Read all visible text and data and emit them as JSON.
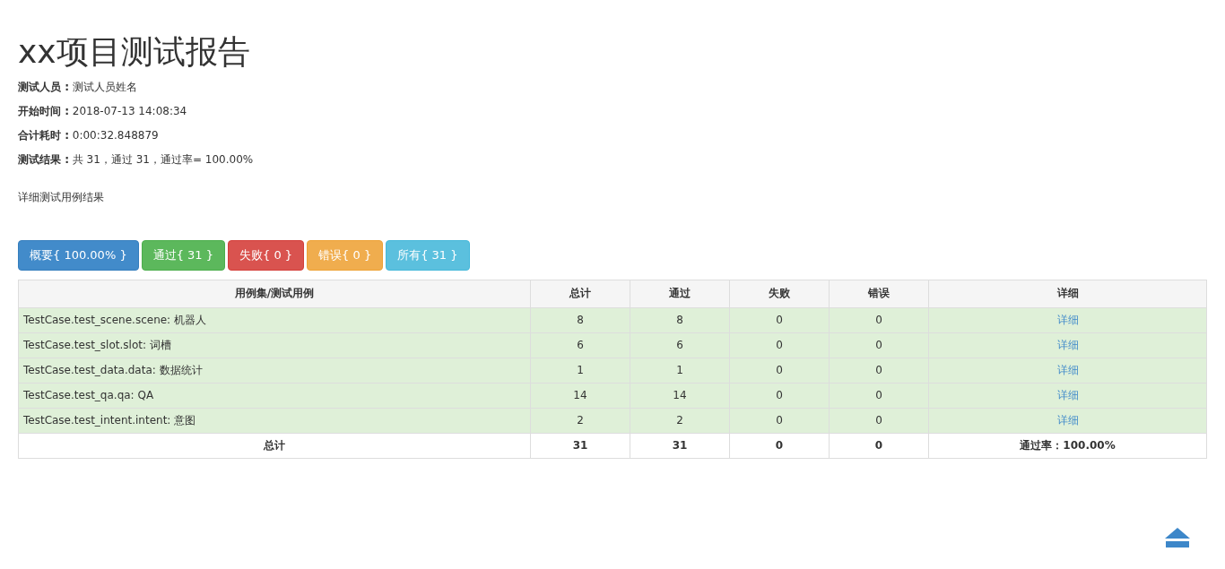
{
  "title": "xx项目测试报告",
  "info": [
    {
      "label": "测试人员 :",
      "value": "测试人员姓名"
    },
    {
      "label": "开始时间 :",
      "value": "2018-07-13 14:08:34"
    },
    {
      "label": "合计耗时 :",
      "value": "0:00:32.848879"
    },
    {
      "label": "测试结果 :",
      "value": "共 31，通过 31，通过率= 100.00%"
    }
  ],
  "description": "详细测试用例结果",
  "filter_buttons": [
    {
      "label": "概要{ 100.00% }",
      "kind": "primary"
    },
    {
      "label": "通过{ 31 }",
      "kind": "success"
    },
    {
      "label": "失败{ 0 }",
      "kind": "danger"
    },
    {
      "label": "错误{ 0 }",
      "kind": "warning"
    },
    {
      "label": "所有{ 31 }",
      "kind": "info"
    }
  ],
  "table": {
    "columns": [
      "用例集/测试用例",
      "总计",
      "通过",
      "失败",
      "错误",
      "详细"
    ],
    "rows": [
      {
        "name": "TestCase.test_scene.scene: 机器人",
        "total": "8",
        "passed": "8",
        "failed": "0",
        "errors": "0",
        "detail": "详细",
        "kind": "pass"
      },
      {
        "name": "TestCase.test_slot.slot: 词槽",
        "total": "6",
        "passed": "6",
        "failed": "0",
        "errors": "0",
        "detail": "详细",
        "kind": "pass"
      },
      {
        "name": "TestCase.test_data.data: 数据统计",
        "total": "1",
        "passed": "1",
        "failed": "0",
        "errors": "0",
        "detail": "详细",
        "kind": "pass"
      },
      {
        "name": "TestCase.test_qa.qa: QA",
        "total": "14",
        "passed": "14",
        "failed": "0",
        "errors": "0",
        "detail": "详细",
        "kind": "pass"
      },
      {
        "name": "TestCase.test_intent.intent: 意图",
        "total": "2",
        "passed": "2",
        "failed": "0",
        "errors": "0",
        "detail": "详细",
        "kind": "pass"
      }
    ],
    "total_row": {
      "label": "总计",
      "total": "31",
      "passed": "31",
      "failed": "0",
      "errors": "0",
      "rate": "通过率：100.00%"
    }
  }
}
